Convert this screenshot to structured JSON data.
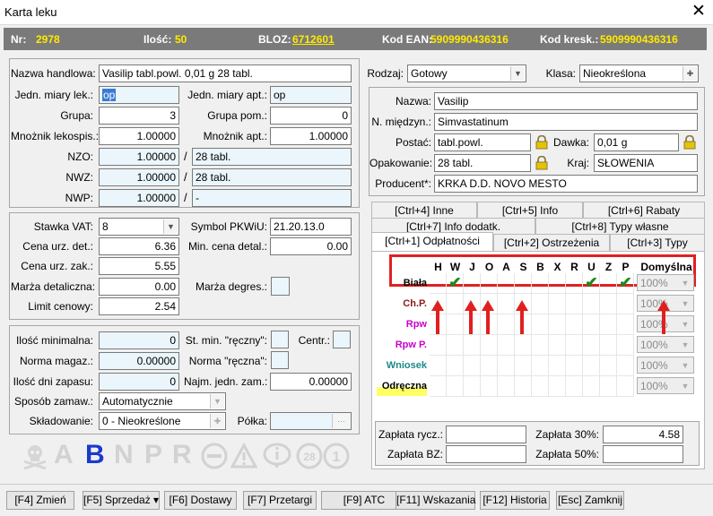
{
  "window": {
    "title": "Karta leku",
    "close": "✕"
  },
  "info": {
    "nr_label": "Nr:",
    "nr": "2978",
    "ilosc_label": "Ilość:",
    "ilosc": "50",
    "bloz_label": "BLOZ:",
    "bloz": "6712601",
    "ean_label": "Kod EAN:",
    "ean": "5909990436316",
    "kresk_label": "Kod kresk.:",
    "kresk": "5909990436316"
  },
  "left": {
    "nazwa_label": "Nazwa handlowa:",
    "nazwa": "Vasilip tabl.powl. 0,01 g 28 tabl.",
    "jml_label": "Jedn. miary lek.:",
    "jml": "op",
    "jma_label": "Jedn. miary apt.:",
    "jma": "op",
    "grupa_label": "Grupa:",
    "grupa": "3",
    "grupa_pom_label": "Grupa pom.:",
    "grupa_pom": "0",
    "mnoz_lek_label": "Mnożnik lekospis.:",
    "mnoz_lek": "1.00000",
    "mnoz_apt_label": "Mnożnik apt.:",
    "mnoz_apt": "1.00000",
    "nzo_label": "NZO:",
    "nzo": "1.00000",
    "nzo_t": "28 tabl.",
    "nwz_label": "NWZ:",
    "nwz": "1.00000",
    "nwz_t": "28 tabl.",
    "nwp_label": "NWP:",
    "nwp": "1.00000",
    "nwp_t": "-",
    "slash": "/"
  },
  "prices": {
    "vat_label": "Stawka VAT:",
    "vat": "8",
    "pkwiu_label": "Symbol PKWiU:",
    "pkwiu": "21.20.13.0",
    "cud_label": "Cena urz. det.:",
    "cud": "6.36",
    "mcd_label": "Min. cena detal.:",
    "mcd": "0.00",
    "cuz_label": "Cena urz. zak.:",
    "cuz": "5.55",
    "mdet_label": "Marża detaliczna:",
    "mdet": "0.00",
    "mdeg_label": "Marża degres.:",
    "limit_label": "Limit cenowy:",
    "limit": "2.54"
  },
  "stock": {
    "imin_label": "Ilość minimalna:",
    "imin": "0",
    "stmin_label": "St. min. \"ręczny\":",
    "centr_label": "Centr.:",
    "norma_label": "Norma magaz.:",
    "norma": "0.00000",
    "normar_label": "Norma \"ręczna\":",
    "idz_label": "Ilość dni zapasu:",
    "idz": "0",
    "najm_label": "Najm. jedn. zam.:",
    "najm": "0.00000",
    "sposob_label": "Sposób zamaw.:",
    "sposob": "Automatycznie",
    "skl_label": "Składowanie:",
    "skl": "0 - Nieokreślone",
    "polka_label": "Półka:",
    "polka_btn": "···"
  },
  "icons_glyphs": [
    "A",
    "B",
    "N",
    "P",
    "R"
  ],
  "right": {
    "rodzaj_label": "Rodzaj:",
    "rodzaj": "Gotowy",
    "klasa_label": "Klasa:",
    "klasa": "Nieokreślona",
    "nazwa_label": "Nazwa:",
    "nazwa": "Vasilip",
    "miedzyn_label": "N. międzyn.:",
    "miedzyn": "Simvastatinum",
    "postac_label": "Postać:",
    "postac": "tabl.powl.",
    "dawka_label": "Dawka:",
    "dawka": "0,01 g",
    "opak_label": "Opakowanie:",
    "opak": "28 tabl.",
    "kraj_label": "Kraj:",
    "kraj": "SŁOWENIA",
    "prod_label": "Producent*:",
    "prod": "KRKA D.D. NOVO MESTO"
  },
  "tabs": {
    "row1": [
      "[Ctrl+4] Inne",
      "[Ctrl+5] Info",
      "[Ctrl+6] Rabaty"
    ],
    "row2": [
      "[Ctrl+7] Info dodatk.",
      "[Ctrl+8] Typy własne"
    ],
    "row3": [
      "[Ctrl+1] Odpłatności",
      "[Ctrl+2] Ostrzeżenia",
      "[Ctrl+3] Typy"
    ]
  },
  "grid": {
    "columns": [
      "H",
      "W",
      "J",
      "O",
      "A",
      "S",
      "B",
      "X",
      "R",
      "U",
      "Z",
      "P"
    ],
    "default_header": "Domyślna",
    "rows": [
      {
        "label": "Biała",
        "color": "#000000",
        "default": "100%"
      },
      {
        "label": "Ch.P.",
        "color": "#8b1a1a",
        "default": "100%"
      },
      {
        "label": "Rpw",
        "color": "#cc00cc",
        "default": "100%"
      },
      {
        "label": "Rpw P.",
        "color": "#cc00cc",
        "default": "100%"
      },
      {
        "label": "Wniosek",
        "color": "#1a8a8a",
        "default": "100%"
      },
      {
        "label": "Odręczna",
        "color": "#000000",
        "default": "100%"
      }
    ],
    "checkmark": "✔"
  },
  "zaplata": {
    "rycz_label": "Zapłata rycz.:",
    "bz_label": "Zapłata BZ:",
    "p30_label": "Zapłata 30%:",
    "p30": "4.58",
    "p50_label": "Zapłata 50%:"
  },
  "buttons": [
    "[F4] Zmień",
    "[F5] Sprzedaż ▾",
    "[F6] Dostawy",
    "[F7] Przetargi",
    "[F9] ATC",
    "[F11] Wskazania",
    "[F12] Historia",
    "[Esc] Zamknij"
  ],
  "colors": {
    "accent_value": "#ffea00",
    "highlight": "#e02020",
    "check": "#1a8a1a"
  }
}
